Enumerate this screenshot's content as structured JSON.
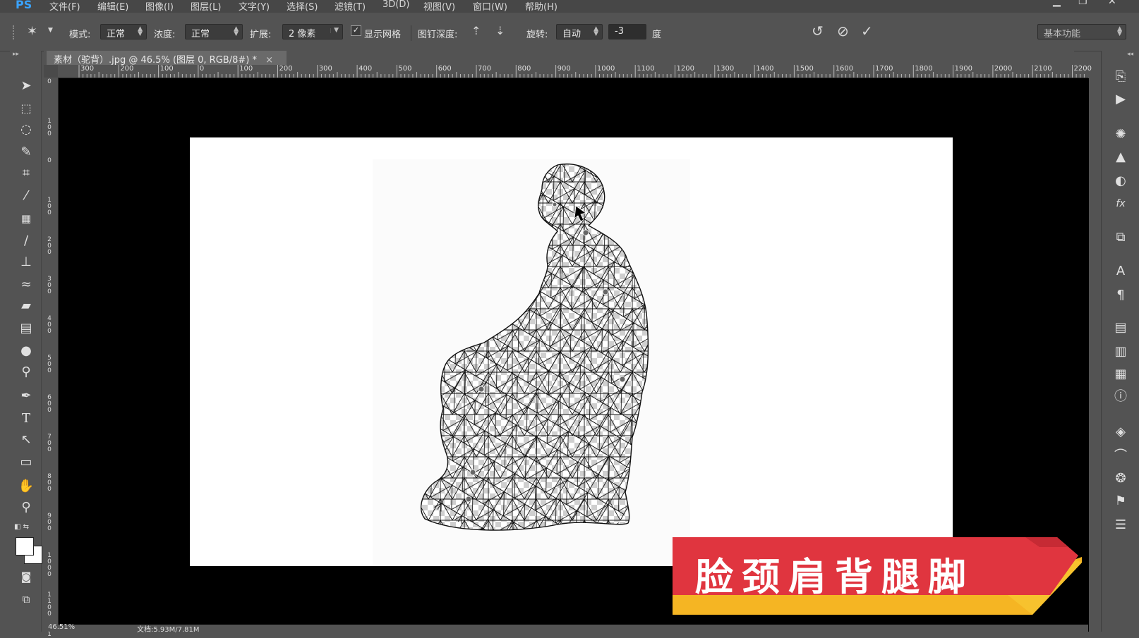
{
  "app": {
    "logo": "PS"
  },
  "menubar": {
    "items": [
      "文件(F)",
      "编辑(E)",
      "图像(I)",
      "图层(L)",
      "文字(Y)",
      "选择(S)",
      "滤镜(T)",
      "3D(D)",
      "视图(V)",
      "窗口(W)",
      "帮助(H)"
    ],
    "window_controls": {
      "minimize": "▁",
      "restore": "❐",
      "close": "✕"
    }
  },
  "options": {
    "mode_label": "模式:",
    "mode_value": "正常",
    "density_label": "浓度:",
    "density_value": "正常",
    "expand_label": "扩展:",
    "expand_value": "2 像素",
    "show_mesh_label": "显示网格",
    "show_mesh_checked": "✓",
    "pin_depth_label": "图钉深度:",
    "rotate_label": "旋转:",
    "rotate_value": "自动",
    "angle_value": "-3",
    "angle_unit": "度",
    "workspace": "基本功能"
  },
  "document": {
    "tab_title": "素材（驼背）.jpg @ 46.5% (图层 0, RGB/8#) *",
    "tab_close": "×"
  },
  "hruler_labels": [
    "300",
    "200",
    "100",
    "0",
    "100",
    "200",
    "300",
    "400",
    "500",
    "600",
    "700",
    "800",
    "900",
    "1000",
    "1100",
    "1200",
    "1300",
    "1400",
    "1500",
    "1600",
    "1700",
    "1800",
    "1900",
    "2000",
    "2100",
    "2200"
  ],
  "vruler_labels": [
    "0",
    "1 0 0",
    "0",
    "1 0 0",
    "2 0 0",
    "3 0 0",
    "4 0 0",
    "5 0 0",
    "6 0 0",
    "7 0 0",
    "8 0 0",
    "9 0 0",
    "1 0 0 0",
    "1 1 0 0",
    "1"
  ],
  "status": {
    "zoom": "46.51%",
    "doc_info": "文档:5.93M/7.81M"
  },
  "banner": {
    "text": "脸颈肩背腿脚",
    "color_red": "#e0353f",
    "color_yellow": "#f5b523"
  },
  "colors": {
    "bg": "#535353",
    "menubar": "#474747",
    "canvas": "#000000"
  }
}
